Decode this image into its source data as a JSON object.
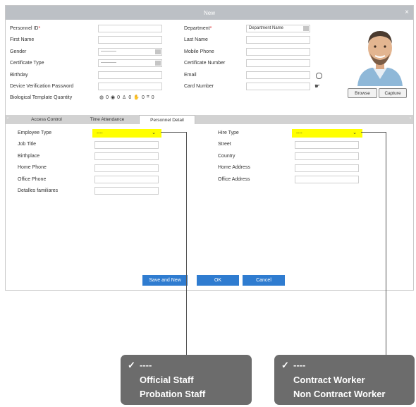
{
  "dialog": {
    "title": "New",
    "close": "×"
  },
  "left_fields": [
    {
      "label": "Personnel ID",
      "required": "*",
      "value": ""
    },
    {
      "label": "First Name",
      "value": ""
    },
    {
      "label": "Gender",
      "value": "-----------"
    },
    {
      "label": "Certificate Type",
      "value": "-----------"
    },
    {
      "label": "Birthday",
      "value": ""
    },
    {
      "label": "Device Verification Password",
      "value": ""
    },
    {
      "label": "Biological Template Quantity",
      "value": ""
    }
  ],
  "biometric_counts": [
    "0",
    "0",
    "0",
    "0",
    "0"
  ],
  "right_fields": [
    {
      "label": "Department",
      "required": "*",
      "value": "Department Name"
    },
    {
      "label": "Last Name",
      "value": ""
    },
    {
      "label": "Mobile Phone",
      "value": ""
    },
    {
      "label": "Certificate Number",
      "value": ""
    },
    {
      "label": "Email",
      "value": ""
    },
    {
      "label": "Card Number",
      "value": ""
    }
  ],
  "photo": {
    "browse": "Browse",
    "capture": "Capture"
  },
  "tabs": [
    {
      "label": "Access Control"
    },
    {
      "label": "Time Attendance"
    },
    {
      "label": "Personnel Detail",
      "active": true
    }
  ],
  "detail_left": [
    {
      "label": "Employee Type",
      "value": "----"
    },
    {
      "label": "Job Title",
      "value": ""
    },
    {
      "label": "Birthplace",
      "value": ""
    },
    {
      "label": "Home Phone",
      "value": ""
    },
    {
      "label": "Office Phone",
      "value": ""
    },
    {
      "label": "Detalles familiares",
      "value": ""
    }
  ],
  "detail_right": [
    {
      "label": "Hire Type",
      "value": "----"
    },
    {
      "label": "Street",
      "value": ""
    },
    {
      "label": "Country",
      "value": ""
    },
    {
      "label": "Home Address",
      "value": ""
    },
    {
      "label": "Office Address",
      "value": ""
    }
  ],
  "buttons": {
    "save_new": "Save and New",
    "ok": "OK",
    "cancel": "Cancel"
  },
  "employee_type_options": {
    "check": "✓",
    "items": [
      "----",
      "Official Staff",
      "Probation Staff"
    ]
  },
  "hire_type_options": {
    "check": "✓",
    "items": [
      "----",
      "Contract Worker",
      "Non Contract Worker"
    ]
  },
  "colors": {
    "titlebar": "#bcc0c5",
    "button_blue": "#2f7cd0",
    "highlight": "#ffff00",
    "popup": "#6c6c6c"
  }
}
